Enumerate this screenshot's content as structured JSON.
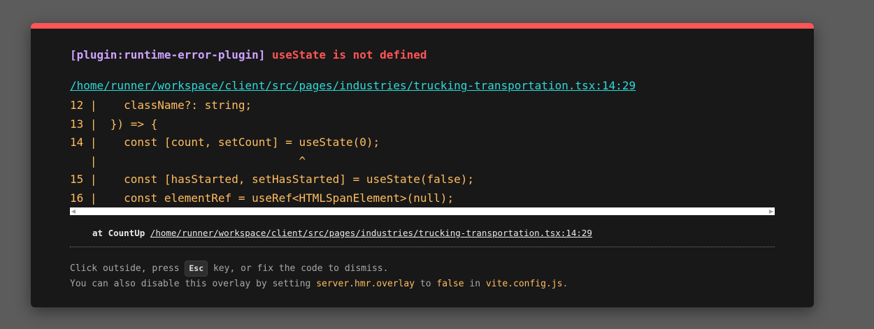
{
  "error": {
    "plugin": "[plugin:runtime-error-plugin]",
    "message": "useState is not defined"
  },
  "file": {
    "location": "/home/runner/workspace/client/src/pages/industries/trucking-transportation.tsx:14:29"
  },
  "frame_lines": [
    "12 |    className?: string;",
    "13 |  }) => {",
    "14 |    const [count, setCount] = useState(0);",
    "   |                              ^",
    "15 |    const [hasStarted, setHasStarted] = useState(false);",
    "16 |    const elementRef = useRef<HTMLSpanElement>(null);"
  ],
  "stack": {
    "prefix": "at CountUp",
    "location": "/home/runner/workspace/client/src/pages/industries/trucking-transportation.tsx:14:29"
  },
  "tip": {
    "line1_before": "Click outside, press ",
    "kbd": "Esc",
    "line1_after": " key, or fix the code to dismiss.",
    "line2_a": "You can also disable this overlay by setting ",
    "line2_code1": "server.hmr.overlay",
    "line2_b": " to ",
    "line2_code2": "false",
    "line2_c": " in ",
    "line2_code3": "vite.config.js",
    "line2_d": "."
  },
  "colors": {
    "accent": "#ff5555",
    "plugin": "#cfa4ff",
    "link": "#2dd9da",
    "code": "#ffbd5f",
    "background": "#181818"
  },
  "icons": {
    "scroll_left": "scroll-left-arrow-icon",
    "scroll_right": "scroll-right-arrow-icon"
  }
}
